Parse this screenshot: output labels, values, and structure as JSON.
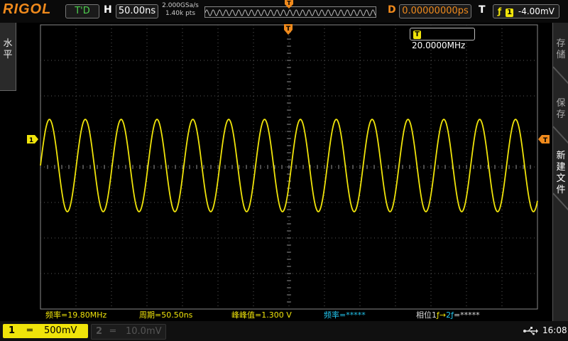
{
  "header": {
    "brand": "RIGOL",
    "run_status": "T'D",
    "horizontal_label": "H",
    "timebase": "50.00ns",
    "sample_rate": "2.000GSa/s",
    "memory_depth": "1.40k pts",
    "delay_label": "D",
    "delay_value": "0.00000000ps",
    "trigger_label": "T",
    "trigger_source": "1",
    "trigger_level": "-4.00mV"
  },
  "left_menu": {
    "chars": [
      "水",
      "平"
    ]
  },
  "right_menu": [
    {
      "chars": [
        "存",
        "储"
      ]
    },
    {
      "chars": [
        "保",
        "存"
      ]
    },
    {
      "chars": [
        "新",
        "建",
        "文",
        "件"
      ]
    }
  ],
  "display": {
    "counter_badge": "T",
    "counter_value": "20.0000MHz",
    "trigger_marker": "T",
    "ch1_marker": "1",
    "trigger_level_marker": "T",
    "colors": {
      "ch1": "#f0e40a",
      "accent": "#f08a1c",
      "grid": "#5a5a5a"
    }
  },
  "measurements": [
    {
      "label": "频率=19.80MHz",
      "color": "#f0e40a"
    },
    {
      "label": "周期=50.50ns",
      "color": "#f0e40a"
    },
    {
      "label": "峰峰值=1.300 V",
      "color": "#f0e40a"
    },
    {
      "label": "频率=*****",
      "color": "#22c7f0"
    },
    {
      "label": "相位1",
      "color": "#dddddd",
      "suffix": "=*****"
    }
  ],
  "channels": [
    {
      "number": "1",
      "coupling": "═",
      "scale": "500mV",
      "active": true
    },
    {
      "number": "2",
      "coupling": "═",
      "scale": "10.0mV",
      "active": false
    }
  ],
  "status": {
    "usb_icon": "usb-icon",
    "time": "16:08"
  },
  "chart_data": {
    "type": "line",
    "series": [
      {
        "waveform": "sine",
        "frequency_mhz": 19.8,
        "period_ns": 50.5,
        "vpp_v": 1.3
      }
    ],
    "timebase_ns_per_div": 50,
    "volts_per_div": 0.5
  }
}
